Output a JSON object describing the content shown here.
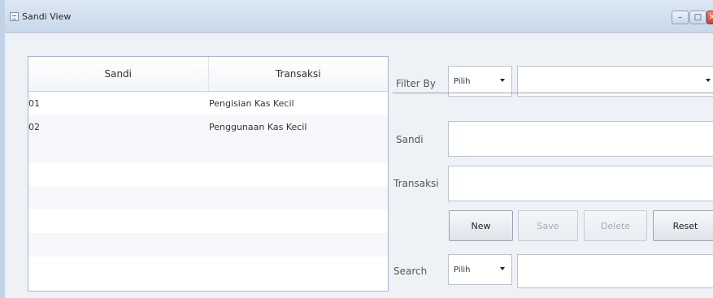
{
  "window": {
    "title": "Sandi View",
    "min_glyph": "–",
    "max_glyph": "□",
    "close_glyph": "✕"
  },
  "grid": {
    "columns": [
      "Sandi",
      "Transaksi"
    ],
    "rows": [
      {
        "sandi": "01",
        "transaksi": "Pengisian Kas Kecil"
      },
      {
        "sandi": "02",
        "transaksi": "Penggunaan Kas Kecil"
      }
    ]
  },
  "filter": {
    "label": "Filter By",
    "selected": "Pilih",
    "value": ""
  },
  "form": {
    "sandi_label": "Sandi",
    "sandi_value": "",
    "transaksi_label": "Transaksi",
    "transaksi_value": ""
  },
  "buttons": {
    "new": "New",
    "save": "Save",
    "delete": "Delete",
    "reset": "Reset"
  },
  "search": {
    "label": "Search",
    "selected": "Pilih",
    "value": ""
  }
}
